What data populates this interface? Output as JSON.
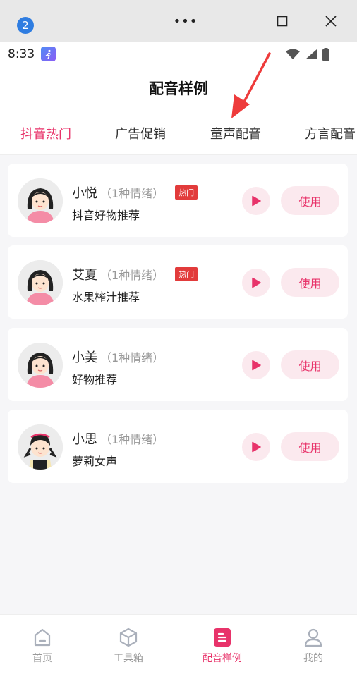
{
  "window": {
    "badge": "2",
    "more_label": "•••"
  },
  "status": {
    "time": "8:33"
  },
  "header": {
    "title": "配音样例"
  },
  "tabs": [
    {
      "label": "抖音热门",
      "active": true
    },
    {
      "label": "广告促销",
      "active": false
    },
    {
      "label": "童声配音",
      "active": false
    },
    {
      "label": "方言配音",
      "active": false
    }
  ],
  "voices": [
    {
      "name": "小悦",
      "emotions": "（1种情绪）",
      "hot": "热门",
      "desc": "抖音好物推荐",
      "play_icon": "play-icon",
      "use_label": "使用"
    },
    {
      "name": "艾夏",
      "emotions": "（1种情绪）",
      "hot": "热门",
      "desc": "水果榨汁推荐",
      "play_icon": "play-icon",
      "use_label": "使用"
    },
    {
      "name": "小美",
      "emotions": "（1种情绪）",
      "hot": "",
      "desc": "好物推荐",
      "play_icon": "play-icon",
      "use_label": "使用"
    },
    {
      "name": "小思",
      "emotions": "（1种情绪）",
      "hot": "",
      "desc": "萝莉女声",
      "play_icon": "play-icon",
      "use_label": "使用"
    }
  ],
  "bottom_nav": [
    {
      "label": "首页",
      "icon": "home-icon",
      "active": false
    },
    {
      "label": "工具箱",
      "icon": "toolbox-icon",
      "active": false
    },
    {
      "label": "配音样例",
      "icon": "document-icon",
      "active": true
    },
    {
      "label": "我的",
      "icon": "profile-icon",
      "active": false
    }
  ],
  "colors": {
    "accent": "#e8336a",
    "hot_badge": "#e23b3b",
    "button_bg": "#fbe9ee"
  }
}
